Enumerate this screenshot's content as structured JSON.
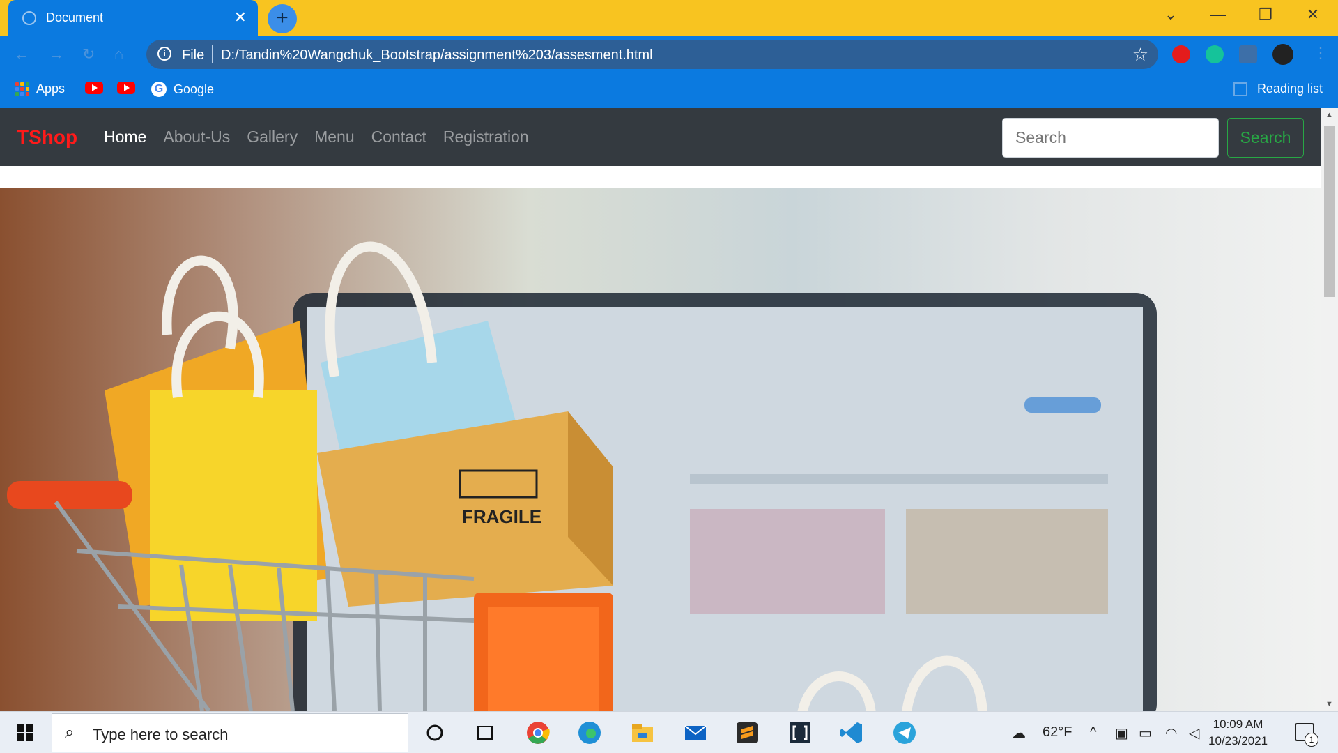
{
  "browser": {
    "tab_title": "Document",
    "tab_close": "✕",
    "new_tab": "+",
    "window_controls": [
      "⌄",
      "—",
      "❐",
      "✕"
    ],
    "file_label": "File",
    "url": "D:/Tandin%20Wangchuk_Bootstrap/assignment%203/assesment.html",
    "bookmarks": [
      {
        "label": "Apps",
        "icon": "apps-grid-icon"
      },
      {
        "label": "",
        "icon": "youtube-icon"
      },
      {
        "label": "",
        "icon": "youtube-icon"
      },
      {
        "label": "Google",
        "icon": "google-icon"
      }
    ],
    "reading_list": "Reading list"
  },
  "site": {
    "brand": "TShop",
    "nav": [
      "Home",
      "About-Us",
      "Gallery",
      "Menu",
      "Contact",
      "Registration"
    ],
    "active_nav": "Home",
    "search_placeholder": "Search",
    "search_button": "Search",
    "hero_box_text": "FRAGILE"
  },
  "taskbar": {
    "search_placeholder": "Type here to search",
    "weather": "62°F",
    "time": "10:09 AM",
    "date": "10/23/2021",
    "notification_count": "1"
  },
  "colors": {
    "chrome_frame": "#f8c420",
    "chrome_toolbar": "#0b7ae0",
    "navbar_bg": "#343a40",
    "brand": "#ff1a1a",
    "search_button": "#28a745"
  }
}
